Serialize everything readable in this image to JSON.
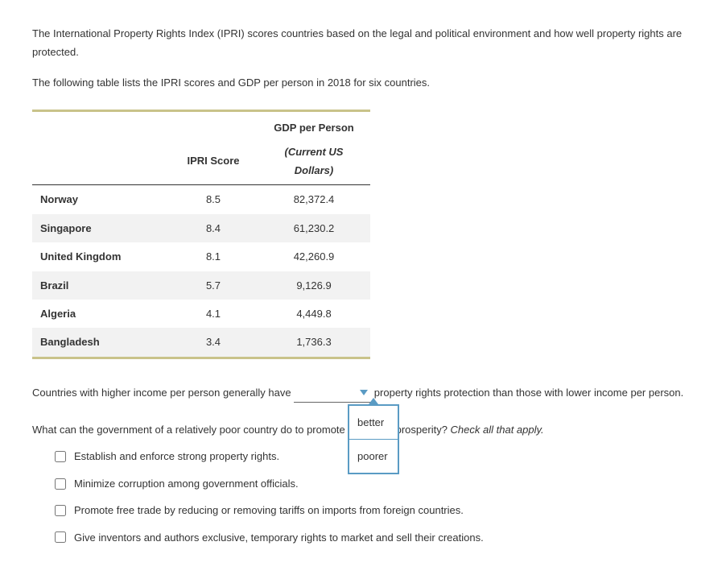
{
  "intro": {
    "p1": "The International Property Rights Index (IPRI) scores countries based on the legal and political environment and how well property rights are protected.",
    "p2": "The following table lists the IPRI scores and GDP per person in 2018 for six countries."
  },
  "table": {
    "headers": {
      "ipri": "IPRI Score",
      "gdp_line1": "GDP per Person",
      "gdp_line2": "(Current US Dollars)"
    },
    "rows": [
      {
        "country": "Norway",
        "score": "8.5",
        "gdp": "82,372.4"
      },
      {
        "country": "Singapore",
        "score": "8.4",
        "gdp": "61,230.2"
      },
      {
        "country": "United Kingdom",
        "score": "8.1",
        "gdp": "42,260.9"
      },
      {
        "country": "Brazil",
        "score": "5.7",
        "gdp": "9,126.9"
      },
      {
        "country": "Algeria",
        "score": "4.1",
        "gdp": "4,449.8"
      },
      {
        "country": "Bangladesh",
        "score": "3.4",
        "gdp": "1,736.3"
      }
    ]
  },
  "q1": {
    "pre": "Countries with higher income per person generally have ",
    "post": " property rights protection than those with lower income per person.",
    "options": [
      "better",
      "poorer"
    ]
  },
  "q2": {
    "pre": "What can the government of a relatively poor country do to promote economic prosperity? ",
    "hint": "Check all that apply.",
    "choices": [
      "Establish and enforce strong property rights.",
      "Minimize corruption among government officials.",
      "Promote free trade by reducing or removing tariffs on imports from foreign countries.",
      "Give inventors and authors exclusive, temporary rights to market and sell their creations."
    ]
  }
}
